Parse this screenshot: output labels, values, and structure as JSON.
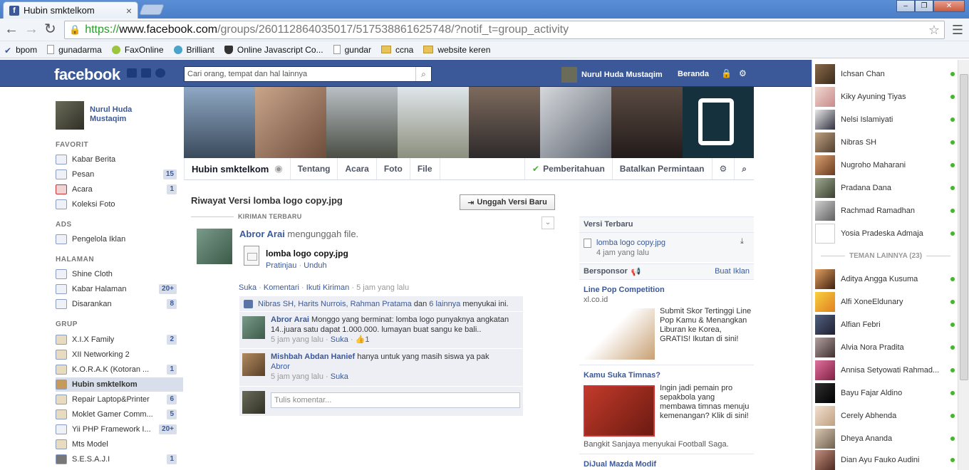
{
  "browser": {
    "tab_title": "Hubin smktelkom",
    "url_https": "https://",
    "url_host": "www.facebook.com",
    "url_path": "/groups/260112864035017/517538861625748/?notif_t=group_activity",
    "bookmarks": [
      {
        "label": "bpom",
        "icon": "check-icon"
      },
      {
        "label": "gunadarma",
        "icon": "page-icon"
      },
      {
        "label": "FaxOnline",
        "icon": "circle-icon"
      },
      {
        "label": "Brilliant",
        "icon": "circle-icon"
      },
      {
        "label": "Online Javascript Co...",
        "icon": "shield-icon"
      },
      {
        "label": "gundar",
        "icon": "page-icon"
      },
      {
        "label": "ccna",
        "icon": "folder-icon"
      },
      {
        "label": "website keren",
        "icon": "folder-icon"
      }
    ]
  },
  "fbbar": {
    "logo": "facebook",
    "search_placeholder": "Cari orang, tempat dan hal lainnya",
    "user_name": "Nurul Huda Mustaqim",
    "home": "Beranda"
  },
  "leftnav": {
    "profile_name": "Nurul Huda Mustaqim",
    "sections": {
      "favorit": "FAVORIT",
      "ads": "ADS",
      "halaman": "HALAMAN",
      "grup": "GRUP"
    },
    "favorit": [
      {
        "label": "Kabar Berita",
        "count": ""
      },
      {
        "label": "Pesan",
        "count": "15"
      },
      {
        "label": "Acara",
        "count": "1"
      },
      {
        "label": "Koleksi Foto",
        "count": ""
      }
    ],
    "ads": [
      {
        "label": "Pengelola Iklan",
        "count": ""
      }
    ],
    "halaman": [
      {
        "label": "Shine Cloth",
        "count": ""
      },
      {
        "label": "Kabar Halaman",
        "count": "20+"
      },
      {
        "label": "Disarankan",
        "count": "8"
      }
    ],
    "grup": [
      {
        "label": "X.I.X Family",
        "count": "2"
      },
      {
        "label": "XII Networking 2",
        "count": ""
      },
      {
        "label": "K.O.R.A.K (Kotoran ...",
        "count": "1"
      },
      {
        "label": "Hubin smktelkom",
        "count": ""
      },
      {
        "label": "Repair Laptop&Printer",
        "count": "6"
      },
      {
        "label": "Moklet Gamer Comm...",
        "count": "5"
      },
      {
        "label": "Yii PHP Framework I...",
        "count": "20+"
      },
      {
        "label": "Mts Model",
        "count": ""
      },
      {
        "label": "S.E.S.A.J.I",
        "count": "1"
      }
    ]
  },
  "group_nav": {
    "title": "Hubin smktelkom",
    "tabs": [
      "Tentang",
      "Acara",
      "Foto",
      "File"
    ],
    "notifications": "Pemberitahuan",
    "cancel_request": "Batalkan Permintaan"
  },
  "main": {
    "title": "Riwayat Versi lomba logo copy.jpg",
    "upload_button": "Unggah Versi Baru",
    "section_header": "KIRIMAN TERBARU",
    "post": {
      "actor": "Abror Arai",
      "action": " mengunggah file.",
      "file_name": "lomba logo copy.jpg",
      "file_preview": "Pratinjau",
      "file_download": "Unduh",
      "like": "Suka",
      "comment": "Komentari",
      "follow": "Ikuti Kiriman",
      "time": "5 jam yang lalu"
    },
    "likes": {
      "names": "Nibras SH, Harits Nurrois, Rahman Pratama",
      "and": " dan ",
      "others": "6 lainnya",
      "suffix": " menyukai ini."
    },
    "comments": [
      {
        "author": "Abror Arai",
        "text": " Monggo yang berminat: lomba logo punyaknya angkatan 14..juara satu dapat 1.000.000. lumayan buat sangu ke bali..",
        "time": "5 jam yang lalu",
        "like": "Suka",
        "like_count": "1"
      },
      {
        "author": "Mishbah Abdan Hanief",
        "text": " hanya untuk yang masih siswa ya pak",
        "mention": "Abror",
        "time": "5 jam yang lalu",
        "like": "Suka"
      }
    ],
    "comment_placeholder": "Tulis komentar..."
  },
  "right": {
    "latest_version_head": "Versi Terbaru",
    "latest_file": "lomba logo copy.jpg",
    "latest_time": "4 jam yang lalu",
    "sponsored_head": "Bersponsor",
    "create_ad": "Buat Iklan",
    "ad1_title": "Line Pop Competition",
    "ad1_url": "xl.co.id",
    "ad1_text": "Submit Skor Tertinggi Line Pop Kamu & Menangkan Liburan ke Korea, GRATIS! Ikutan di sini!",
    "ad2_title": "Kamu Suka Timnas?",
    "ad2_text": "Ingin jadi pemain pro sepakbola yang membawa timnas menuju kemenangan? Klik di sini!",
    "ad2_social": "Bangkit Sanjaya menyukai Football Saga.",
    "ad3_title": "DiJual Mazda Modif"
  },
  "chat": {
    "online": [
      "Ichsan Chan",
      "Kiky Ayuning Tiyas",
      "Nelsi Islamiyati",
      "Nibras SH",
      "Nugroho Maharani",
      "Pradana Dana",
      "Rachmad Ramadhan",
      "Yosia Pradeska Admaja"
    ],
    "other_header": "TEMAN LAINNYA (23)",
    "others": [
      "Aditya Angga Kusuma",
      "Alfi XoneEldunary",
      "Alfian Febri",
      "Alvia Nora Pradita",
      "Annisa Setyowati Rahmad...",
      "Bayu Fajar Aldino",
      "Cerely Abhenda",
      "Dheya Ananda",
      "Dian Ayu Fauko Audini"
    ]
  },
  "colors": {
    "brand": "#3b5998",
    "online": "#42b72a"
  }
}
